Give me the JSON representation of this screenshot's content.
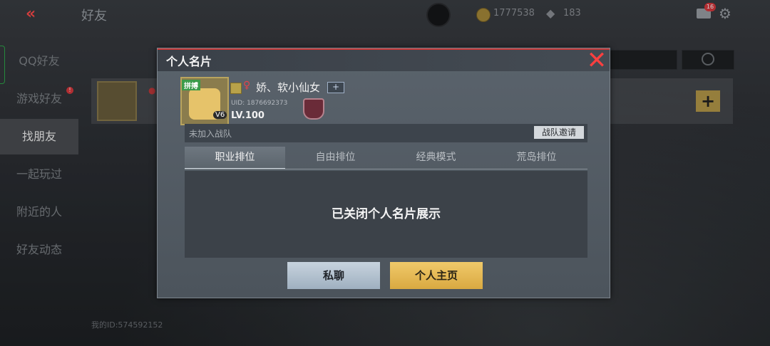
{
  "header": {
    "title": "好友",
    "coins": "1777538",
    "gems": "183",
    "mail_badge": "16"
  },
  "sidebar": {
    "items": [
      {
        "label": "QQ好友"
      },
      {
        "label": "游戏好友",
        "badge": "!"
      },
      {
        "label": "找朋友"
      },
      {
        "label": "一起玩过"
      },
      {
        "label": "附近的人"
      },
      {
        "label": "好友动态"
      }
    ]
  },
  "footer": {
    "my_id": "我的ID:574592152"
  },
  "modal": {
    "title": "个人名片",
    "player": {
      "avatar_tag": "拼搏",
      "avatar_badge": "V6",
      "name": "娇、软小仙女",
      "plus_label": "+",
      "uid": "UID: 1876692373",
      "level": "LV.100"
    },
    "team": {
      "status": "未加入战队",
      "invite_label": "战队邀请"
    },
    "tabs": [
      {
        "label": "职业排位"
      },
      {
        "label": "自由排位"
      },
      {
        "label": "经典模式"
      },
      {
        "label": "荒岛排位"
      }
    ],
    "closed_message": "已关闭个人名片展示",
    "buttons": {
      "chat": "私聊",
      "homepage": "个人主页"
    }
  },
  "icons": {
    "back": "double-chevron-left-icon",
    "close": "close-icon",
    "gear": "gear-icon",
    "mail": "mail-icon",
    "search": "search-icon"
  },
  "colors": {
    "accent_red": "#ff3f3f",
    "gold_button": "#d9a941",
    "blue_button": "#9fb0c0"
  }
}
